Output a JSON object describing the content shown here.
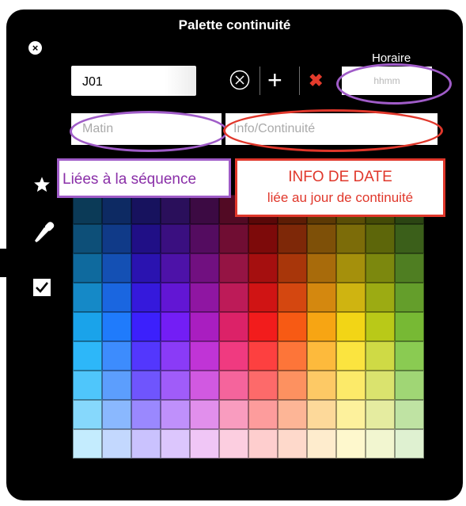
{
  "window": {
    "title": "Palette continuité"
  },
  "icons": {
    "close": "close-icon",
    "clear": "circle-x-icon",
    "add": "plus-icon",
    "remove": "red-x-icon",
    "favorite": "star-icon",
    "eyedropper": "eyedropper-icon",
    "check": "checkbox-icon"
  },
  "buttons": {
    "close_label": "×",
    "add_label": "+",
    "remove_label": "✖"
  },
  "fields": {
    "day": {
      "value": "J01"
    },
    "hour": {
      "label": "Horaire",
      "placeholder": "hhmm"
    },
    "period": {
      "placeholder": "Matin"
    },
    "info": {
      "placeholder": "Info/Continuité"
    }
  },
  "annotations": {
    "sequence": "Liées à la séquence",
    "date_title": "INFO DE DATE",
    "date_subtitle": "liée au jour de continuité",
    "purple_color": "#a05cc8",
    "red_color": "#e0372b"
  },
  "palette": {
    "columns": 12,
    "rows": [
      [
        "#0b3a57",
        "#0d2a63",
        "#17125e",
        "#2a0f5b",
        "#3c0a43",
        "#520a24",
        "#5a0808",
        "#5d1d05",
        "#5d3a05",
        "#5a4e06",
        "#444b07",
        "#2b4513"
      ],
      [
        "#0d4f78",
        "#103a88",
        "#200f86",
        "#3a0f80",
        "#540c60",
        "#700d33",
        "#7d0a0a",
        "#7e2808",
        "#7e5008",
        "#7c6c09",
        "#5d660a",
        "#3b5f1a"
      ],
      [
        "#0f6a9e",
        "#1450b4",
        "#2a13b0",
        "#4d12a8",
        "#711080",
        "#951444",
        "#a50f0f",
        "#a8360a",
        "#a86b0b",
        "#a5900c",
        "#7c880e",
        "#4f7e22"
      ],
      [
        "#1589c7",
        "#1a66e0",
        "#3519dc",
        "#6216d4",
        "#8f16a2",
        "#bd1b58",
        "#d01414",
        "#d44710",
        "#d4880f",
        "#cfb411",
        "#9cab13",
        "#649e2b"
      ],
      [
        "#1aa3ea",
        "#1f7bfc",
        "#3c20fc",
        "#731ef5",
        "#a91ec0",
        "#dc2268",
        "#f21c1c",
        "#f75a14",
        "#f7a513",
        "#f2d516",
        "#b9c918",
        "#77b934"
      ],
      [
        "#2db7f9",
        "#3d8cfd",
        "#5337fd",
        "#8a3bf7",
        "#c034d6",
        "#f03a80",
        "#fd4040",
        "#fd7539",
        "#fdba3c",
        "#fbe43f",
        "#cfda45",
        "#8acb52"
      ],
      [
        "#4fc6fb",
        "#5c9efd",
        "#6f55fd",
        "#a05cf9",
        "#d159e1",
        "#f5649c",
        "#fd6a6a",
        "#fd9160",
        "#fdc965",
        "#fcea69",
        "#dae36e",
        "#a0d675"
      ],
      [
        "#86d8fc",
        "#8ab8fe",
        "#9a88fe",
        "#bf90fb",
        "#e18fec",
        "#f99cbf",
        "#fd9c9c",
        "#fdb596",
        "#fdd99a",
        "#fdf19c",
        "#e5eca0",
        "#bfe3a3"
      ],
      [
        "#c4ecfe",
        "#c3d8fe",
        "#cac2fe",
        "#dcc6fd",
        "#f0c6f6",
        "#fccee0",
        "#fecece",
        "#fed9cb",
        "#feeccd",
        "#fef8cd",
        "#f2f6d0",
        "#dff1d1"
      ]
    ]
  }
}
